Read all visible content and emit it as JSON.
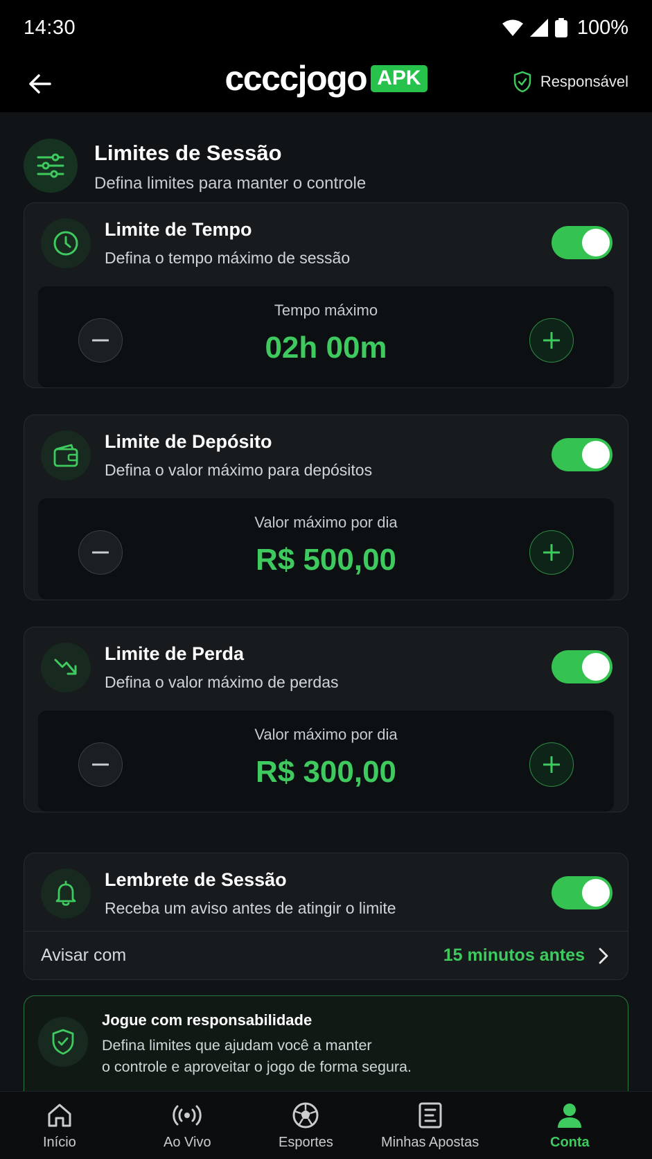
{
  "status_bar": {
    "time": "14:30",
    "battery": "100%"
  },
  "header": {
    "brand_name": "ccccjogo",
    "brand_badge": "APK",
    "responsible_label": "Responsável"
  },
  "section": {
    "title": "Limites de Sessão",
    "subtitle": "Defina limites para manter o controle"
  },
  "cards": [
    {
      "title": "Limite de Tempo",
      "subtitle": "Defina o tempo máximo de sessão",
      "enabled": true,
      "stepper_label": "Tempo máximo",
      "stepper_value": "02h 00m"
    },
    {
      "title": "Limite de Depósito",
      "subtitle": "Defina o valor máximo para depósitos",
      "enabled": true,
      "stepper_label": "Valor máximo por dia",
      "stepper_value": "R$ 500,00"
    },
    {
      "title": "Limite de Perda",
      "subtitle": "Defina o valor máximo de perdas",
      "enabled": true,
      "stepper_label": "Valor máximo por dia",
      "stepper_value": "R$ 300,00"
    }
  ],
  "reminder": {
    "title": "Lembrete de Sessão",
    "subtitle": "Receba um aviso antes de atingir o limite",
    "enabled": true,
    "row_label": "Avisar com",
    "row_value": "15 minutos antes"
  },
  "info": {
    "title": "Jogue com responsabilidade",
    "line1": "Defina limites que ajudam você a manter",
    "line2": "o controle e aproveitar o jogo de forma segura."
  },
  "nav": [
    {
      "label": "Início",
      "icon": "home-icon",
      "active": false
    },
    {
      "label": "Ao Vivo",
      "icon": "live-icon",
      "active": false
    },
    {
      "label": "Esportes",
      "icon": "soccer-ball-icon",
      "active": false
    },
    {
      "label": "Minhas Apostas",
      "icon": "bet-slip-icon",
      "active": false
    },
    {
      "label": "Conta",
      "icon": "user-icon",
      "active": true
    }
  ],
  "colors": {
    "accent": "#3fca5f",
    "toggle_on": "#34c251",
    "background": "#111417",
    "card": "#171b1e"
  }
}
